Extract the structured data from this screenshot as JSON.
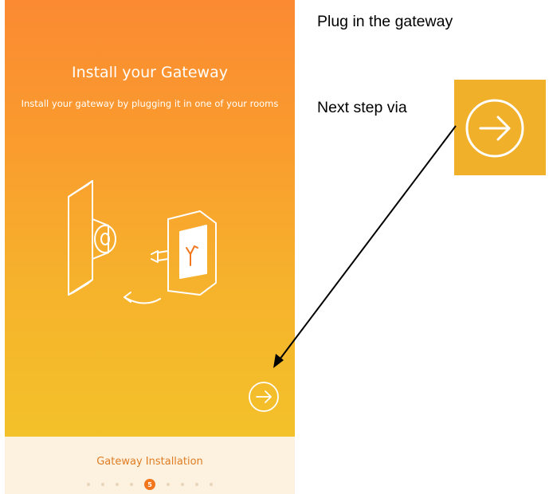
{
  "screen": {
    "title": "Install your Gateway",
    "subtitle": "Install your gateway by plugging it in one of your rooms",
    "next_icon": "arrow-right-circle-icon"
  },
  "footer": {
    "label": "Gateway Installation",
    "steps": [
      "",
      "",
      "",
      "",
      "5",
      "",
      "",
      "",
      ""
    ],
    "current_step": "5"
  },
  "annotations": {
    "plug_text": "Plug in the gateway",
    "next_text": "Next step via"
  },
  "colors": {
    "gradient_top": "#fb8a32",
    "gradient_bottom": "#f3c12a",
    "footer_bg": "#fdf2e0",
    "accent": "#f1761c"
  }
}
